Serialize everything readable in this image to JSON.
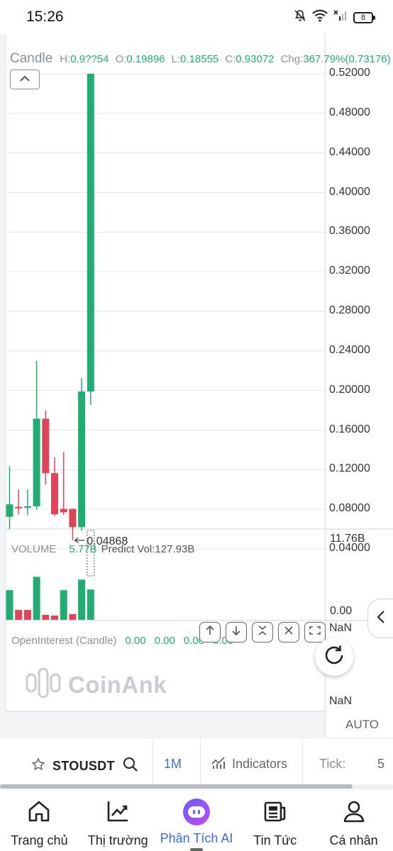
{
  "status_bar": {
    "time": "15:26",
    "battery": "8",
    "icons": [
      "mute-bell-icon",
      "wifi-icon",
      "no-sim-icon",
      "battery-icon"
    ]
  },
  "chart": {
    "legend": {
      "title": "Candle",
      "h_label": "H:",
      "h_value": "0.9??54",
      "o_label": "O:",
      "o_value": "0.19896",
      "l_label": "L:",
      "l_value": "0.18555",
      "c_label": "C:",
      "c_value": "0.93072",
      "chg_label": "Chg:",
      "chg_value": "367.79%(0.73176)"
    },
    "low_marker": "0.04868",
    "volume_legend": {
      "label": "VOLUME",
      "value": "5.77B",
      "predict": "Predict Vol:127.93B"
    },
    "oi_legend": {
      "label": "OpenInterest (Candle)",
      "values": [
        "0.00",
        "0.00",
        "0.00",
        "0.00"
      ]
    },
    "nan_top": "NaN",
    "nan_bottom": "NaN",
    "auto_label": "AUTO",
    "watermark": "CoinAnk",
    "colors": {
      "up": "#22ab73",
      "down": "#e0435a",
      "grid": "#e3e6ea",
      "accent": "#3c6cd8"
    }
  },
  "chart_data": [
    {
      "type": "candlestick",
      "title": "",
      "y_ticks": [
        "0.52000",
        "0.48000",
        "0.44000",
        "0.40000",
        "0.36000",
        "0.32000",
        "0.28000",
        "0.24000",
        "0.20000",
        "0.16000",
        "0.12000",
        "0.08000",
        "0.04000"
      ],
      "ylim": [
        0.04,
        0.52
      ],
      "candles": [
        {
          "o": 0.0725,
          "h": 0.1235,
          "l": 0.06,
          "c": 0.085
        },
        {
          "o": 0.0825,
          "h": 0.1,
          "l": 0.075,
          "c": 0.081
        },
        {
          "o": 0.083,
          "h": 0.1,
          "l": 0.074,
          "c": 0.083
        },
        {
          "o": 0.083,
          "h": 0.23,
          "l": 0.0795,
          "c": 0.1715
        },
        {
          "o": 0.1715,
          "h": 0.18,
          "l": 0.105,
          "c": 0.1165
        },
        {
          "o": 0.1165,
          "h": 0.1325,
          "l": 0.0735,
          "c": 0.075
        },
        {
          "o": 0.0805,
          "h": 0.138,
          "l": 0.0745,
          "c": 0.077
        },
        {
          "o": 0.0805,
          "h": 0.0805,
          "l": 0.0487,
          "c": 0.062
        },
        {
          "o": 0.062,
          "h": 0.2125,
          "l": 0.0585,
          "c": 0.199
        },
        {
          "o": 0.199,
          "h": 0.52,
          "l": 0.1855,
          "c": 0.52
        }
      ],
      "low_marker": 0.04868
    },
    {
      "type": "bar",
      "title": "",
      "y_ticks": [
        "11.76B",
        "0.00"
      ],
      "ylim": [
        0,
        11.76
      ],
      "unit": "B",
      "values": [
        4.2,
        1.4,
        1.4,
        6.1,
        0.7,
        0.6,
        4.2,
        0.8,
        5.7,
        4.3
      ],
      "directions": [
        "up",
        "down",
        "down",
        "up",
        "down",
        "down",
        "up",
        "down",
        "up",
        "up"
      ]
    }
  ],
  "toolbar": {
    "symbol": "STOUSDT",
    "interval": "1M",
    "indicators": "Indicators",
    "tick_label": "Tick:",
    "tick_value": "5"
  },
  "bottom_nav": [
    {
      "label": "Trang chủ",
      "icon": "home-icon"
    },
    {
      "label": "Thị trường",
      "icon": "market-chart-icon"
    },
    {
      "label": "Phân Tích AI",
      "icon": "ai-bot-icon",
      "active": true
    },
    {
      "label": "Tin Tức",
      "icon": "news-icon"
    },
    {
      "label": "Cá nhân",
      "icon": "user-icon"
    }
  ]
}
